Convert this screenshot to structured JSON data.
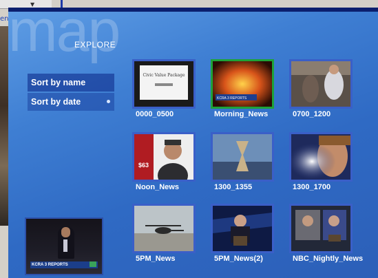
{
  "app": {
    "background_word": "map",
    "header_label": "EXPLORE",
    "left_link_text": "en"
  },
  "sort": {
    "by_name": "Sort by name",
    "by_date": "Sort by date"
  },
  "tiles": [
    {
      "label": "0000_0500",
      "thumb_text": "Civic Value Package"
    },
    {
      "label": "Morning_News",
      "thumb_text": "KCRA 3 REPORTS"
    },
    {
      "label": "0700_1200"
    },
    {
      "label": "Noon_News",
      "thumb_text": "$63"
    },
    {
      "label": "1300_1355"
    },
    {
      "label": "1300_1700"
    },
    {
      "label": "5PM_News"
    },
    {
      "label": "5PM_News(2)"
    },
    {
      "label": "NBC_Nightly_News"
    }
  ],
  "preview": {
    "caption": "KCRA 3 REPORTS"
  },
  "colors": {
    "panel": "#3f7fd3",
    "tile_border": "#3a5fc8",
    "selected_border": "#1ea23a"
  }
}
